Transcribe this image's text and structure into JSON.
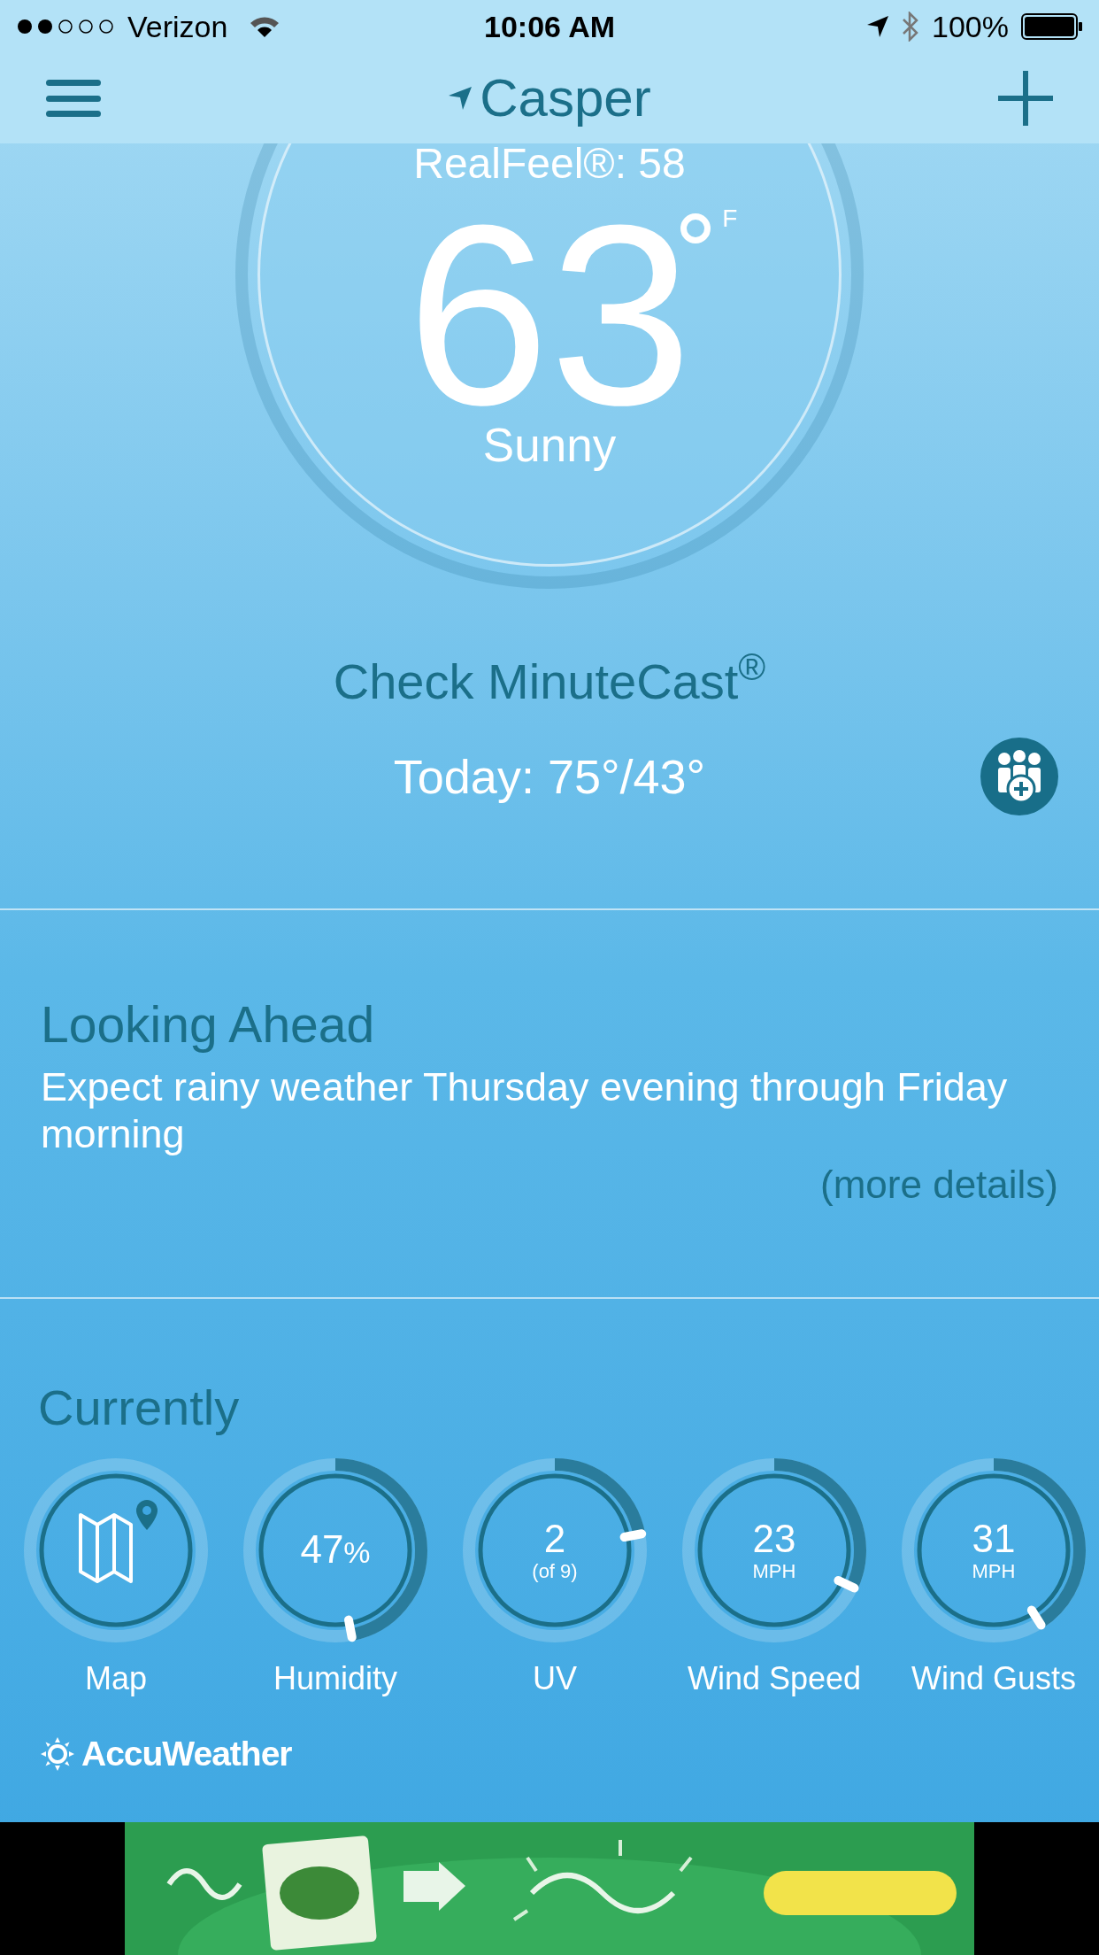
{
  "status_bar": {
    "carrier": "Verizon",
    "time": "10:06 AM",
    "battery": "100%"
  },
  "header": {
    "location": "Casper"
  },
  "current": {
    "realfeel": "RealFeel®: 58",
    "temperature": "63",
    "unit": "F",
    "condition": "Sunny",
    "minutecast": "Check MinuteCast$^{®}$",
    "today": "Today: 75°/43°"
  },
  "looking_ahead": {
    "title": "Looking Ahead",
    "text": "Expect rainy weather Thursday evening through Friday morning",
    "link": "(more details)"
  },
  "currently": {
    "title": "Currently",
    "gauges": [
      {
        "kind": "map",
        "label": "Map"
      },
      {
        "kind": "dial",
        "value": "47",
        "unit": "%",
        "level": 0.47,
        "label": "Humidity"
      },
      {
        "kind": "dial",
        "value": "2",
        "sub": "(of 9)",
        "level": 0.22,
        "label": "UV"
      },
      {
        "kind": "dial",
        "value": "23",
        "sub": "MPH",
        "level": 0.32,
        "label": "Wind Speed"
      },
      {
        "kind": "dial",
        "value": "31",
        "sub": "MPH",
        "level": 0.41,
        "label": "Wind Gusts"
      }
    ]
  },
  "brand": "AccuWeather"
}
